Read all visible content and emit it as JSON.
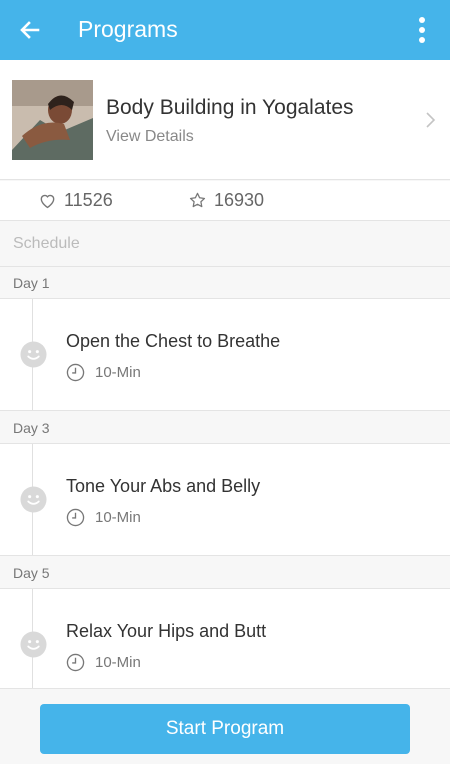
{
  "appbar": {
    "title": "Programs"
  },
  "program": {
    "name": "Body Building in Yogalates",
    "details_label": "View Details"
  },
  "stats": {
    "likes": "11526",
    "stars": "16930"
  },
  "schedule_label": "Schedule",
  "sessions": [
    {
      "day": "Day 1",
      "title": "Open the Chest to Breathe",
      "duration": "10-Min"
    },
    {
      "day": "Day 3",
      "title": "Tone Your Abs and Belly",
      "duration": "10-Min"
    },
    {
      "day": "Day 5",
      "title": "Relax Your Hips and Butt",
      "duration": "10-Min"
    }
  ],
  "footer": {
    "start_label": "Start Program"
  },
  "colors": {
    "accent": "#45b4ea",
    "text": "#333333",
    "muted": "#888888",
    "divider": "#e4e4e4"
  },
  "icons": {
    "back": "arrow-left-icon",
    "more": "more-vertical-icon",
    "like": "heart-outline-icon",
    "favorite": "star-outline-icon",
    "session": "smiley-icon",
    "duration": "clock-icon",
    "open": "chevron-right-icon"
  }
}
